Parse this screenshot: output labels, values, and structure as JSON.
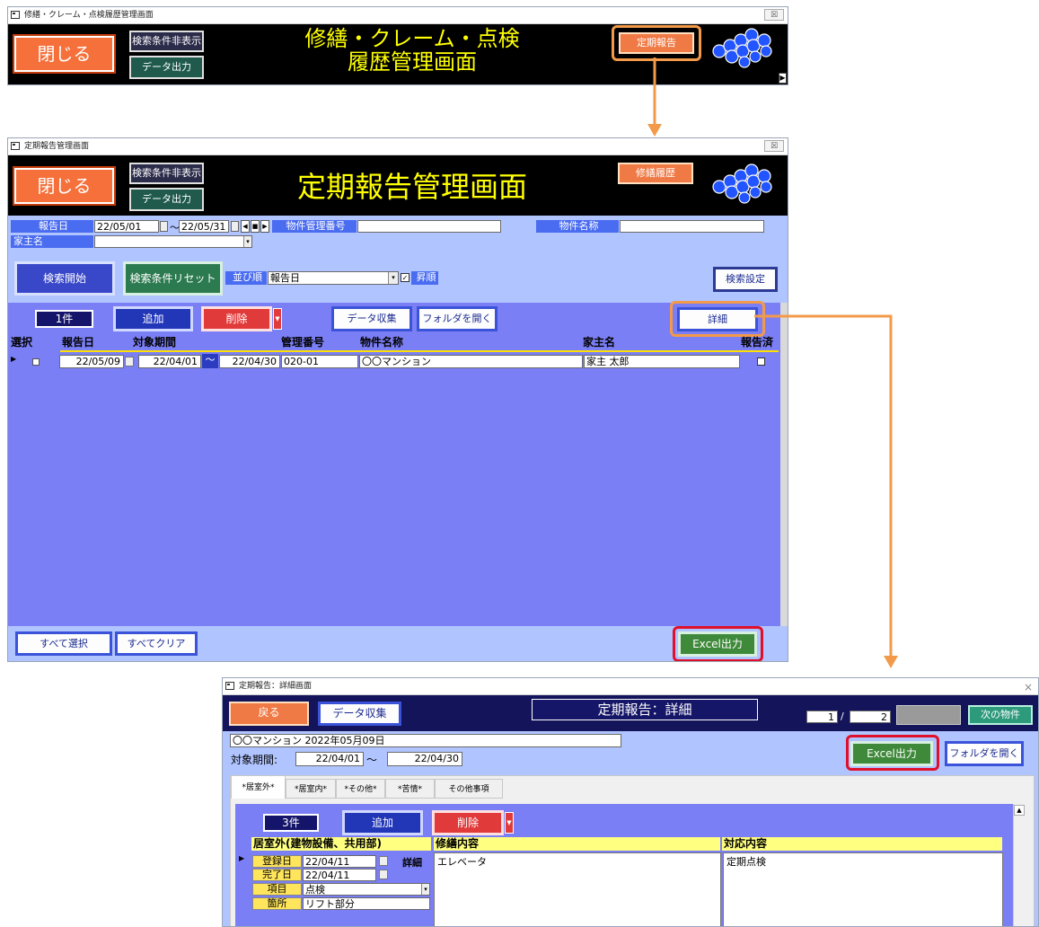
{
  "win1": {
    "title": "修繕・クレーム・点検履歴管理画面",
    "close": "閉じる",
    "hide_search": "検索条件非表示",
    "data_output": "データ出力",
    "heading_line1": "修繕・クレーム・点検",
    "heading_line2": "履歴管理画面",
    "teiki_button": "定期報告"
  },
  "win2": {
    "title": "定期報告管理画面",
    "close": "閉じる",
    "hide_search": "検索条件非表示",
    "data_output": "データ出力",
    "heading": "定期報告管理画面",
    "shuzen_button": "修繕履歴",
    "filter": {
      "report_date_label": "報告日",
      "date_from": "22/05/01",
      "date_to": "22/05/31",
      "tilde": "～",
      "property_no_label": "物件管理番号",
      "property_name_label": "物件名称",
      "owner_label": "家主名"
    },
    "search_start": "検索開始",
    "search_reset": "検索条件リセット",
    "sort_label": "並び順",
    "sort_value": "報告日",
    "asc_label": "昇順",
    "search_settings": "検索設定",
    "count": "1件",
    "add": "追加",
    "delete": "削除",
    "data_collect": "データ収集",
    "open_folder": "フォルダを開く",
    "detail": "詳細",
    "columns": [
      "選択",
      "報告日",
      "対象期間",
      "管理番号",
      "物件名称",
      "家主名",
      "報告済"
    ],
    "row": {
      "report_date": "22/05/09",
      "period_from": "22/04/01",
      "tilde": "～",
      "period_to": "22/04/30",
      "mgmt_no": "020-01",
      "property": "〇〇マンション",
      "owner": "家主 太郎"
    },
    "select_all": "すべて選択",
    "clear_all": "すべてクリア",
    "excel": "Excel出力"
  },
  "win3": {
    "title": "定期報告：詳細画面",
    "back": "戻る",
    "data_collect": "データ収集",
    "heading": "定期報告：詳細",
    "page_current": "1",
    "page_sep": "/",
    "page_total": "2",
    "next": "次の物件",
    "property_line": "〇〇マンション 2022年05月09日",
    "period_label": "対象期間:",
    "period_from": "22/04/01",
    "tilde": "～",
    "period_to": "22/04/30",
    "excel": "Excel出力",
    "open_folder": "フォルダを開く",
    "tabs": [
      "*居室外*",
      "*居室内*",
      "*その他*",
      "*苦情*",
      "その他事項"
    ],
    "count": "3件",
    "add": "追加",
    "delete": "削除",
    "col_outside": "居室外(建物設備、共用部)",
    "col_repair": "修繕内容",
    "col_response": "対応内容",
    "reg_label": "登録日",
    "reg_date": "22/04/11",
    "detail": "詳細",
    "done_label": "完了日",
    "done_date": "22/04/11",
    "item_label": "項目",
    "item_value": "点検",
    "place_label": "箇所",
    "place_value": "リフト部分",
    "repair_text": "エレベータ",
    "response_text": "定期点検"
  }
}
